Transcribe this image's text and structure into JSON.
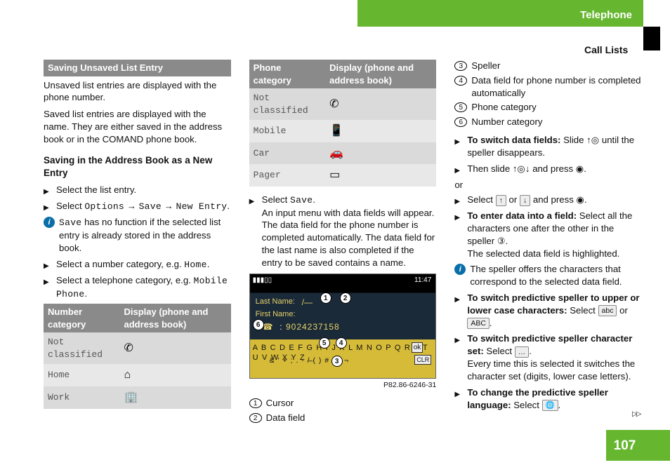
{
  "header": {
    "chapter": "Telephone",
    "section": "Call Lists",
    "page": "107"
  },
  "col1": {
    "bar": "Saving Unsaved List Entry",
    "p1": "Unsaved list entries are displayed with the phone number.",
    "p2": "Saved list entries are displayed with the name. They are either saved in the address book or in the COMAND phone book.",
    "sub": "Saving in the Address Book as a New Entry",
    "s1": "Select the list entry.",
    "s2a": "Select ",
    "s2b": "Options",
    "s2c": " → ",
    "s2d": "Save",
    "s2e": " → ",
    "s2f": "New Entry",
    "s2g": ".",
    "info1a": "Save",
    "info1b": " has no function if the selected list entry is already stored in the address book.",
    "s3a": "Select a number category, e.g. ",
    "s3b": "Home",
    "s3c": ".",
    "s4a": "Select a telephone category, e.g. ",
    "s4b": "Mobile Phone",
    "s4c": ".",
    "numTable": {
      "h1": "Number category",
      "h2": "Display (phone and address book)",
      "rows": [
        {
          "label": "Not classified",
          "icon": "✆"
        },
        {
          "label": "Home",
          "icon": "⌂"
        },
        {
          "label": "Work",
          "icon": "🏢"
        }
      ]
    }
  },
  "col2": {
    "phoneTable": {
      "h1": "Phone category",
      "h2": "Display (phone and address book)",
      "rows": [
        {
          "label": "Not classified",
          "icon": "✆"
        },
        {
          "label": "Mobile",
          "icon": "📱"
        },
        {
          "label": "Car",
          "icon": "🚗"
        },
        {
          "label": "Pager",
          "icon": "▭"
        }
      ]
    },
    "s1a": "Select ",
    "s1b": "Save",
    "s1c": ".",
    "s1d": "An input menu with data fields will appear. The data field for the phone number is completed automatically. The data field for the last name is also completed if the entry to be saved contains a name.",
    "diag": {
      "last": "Last Name:",
      "first": "First Name:",
      "num": "9024237158",
      "row1": "A B C D E F G H I J K L M N O P Q R S T U V W X Y Z _",
      "row2": "& ' + ; . - / ( ) # : * ¬",
      "ok": "ok",
      "clr": "CLR",
      "time": "11:47",
      "caption": "P82.86-6246-31"
    },
    "c1": "Cursor",
    "c2": "Data field"
  },
  "col3": {
    "c3": "Speller",
    "c4": "Data field for phone number is completed automatically",
    "c5": "Phone category",
    "c6": "Number category",
    "s1a": "To switch data fields:",
    "s1b": " Slide ",
    "s1c": " until the speller disappears.",
    "s2a": "Then slide ",
    "s2b": " and press ",
    "s2c": ".",
    "or": "or",
    "s3a": "Select ",
    "s3b": " or ",
    "s3c": " and press ",
    "s3d": ".",
    "s4a": "To enter data into a field:",
    "s4b": " Select all the characters one after the other in the speller ③.",
    "s4c": "The selected data field is highlighted.",
    "info2": "The speller offers the characters that correspond to the selected data field.",
    "s5a": "To switch predictive speller to upper or lower case characters:",
    "s5b": " Select ",
    "s5key1": "abc",
    "s5c": " or ",
    "s5key2": "ABC",
    "s5d": ".",
    "s6a": "To switch predictive speller character set:",
    "s6b": " Select ",
    "s6key": "…",
    "s6c": ".",
    "s6d": "Every time this is selected it switches the character set (digits, lower case letters).",
    "s7a": "To change the predictive speller language:",
    "s7b": " Select ",
    "s7key": "🌐",
    "s7c": "."
  }
}
